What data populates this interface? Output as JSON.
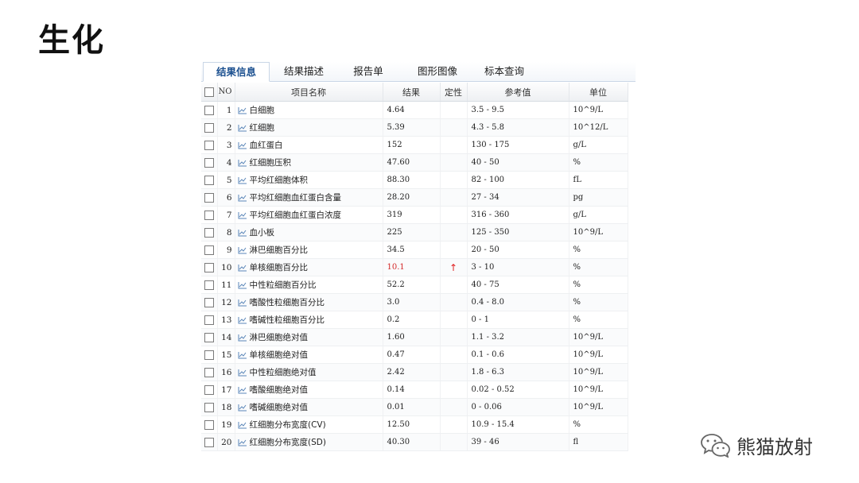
{
  "slide": {
    "title": "生化"
  },
  "tabs": [
    {
      "label": "结果信息",
      "active": true
    },
    {
      "label": "结果描述",
      "active": false
    },
    {
      "label": "报告单",
      "active": false
    },
    {
      "label": "图形图像",
      "active": false
    },
    {
      "label": "标本查询",
      "active": false
    }
  ],
  "table": {
    "headers": {
      "no": "NO",
      "name": "项目名称",
      "result": "结果",
      "flag": "定性",
      "ref": "参考值",
      "unit": "单位"
    },
    "rows": [
      {
        "no": "1",
        "name": "白细胞",
        "result": "4.64",
        "flag": "",
        "ref": "3.5 - 9.5",
        "unit": "10^9/L",
        "abnormal": false
      },
      {
        "no": "2",
        "name": "红细胞",
        "result": "5.39",
        "flag": "",
        "ref": "4.3 - 5.8",
        "unit": "10^12/L",
        "abnormal": false
      },
      {
        "no": "3",
        "name": "血红蛋白",
        "result": "152",
        "flag": "",
        "ref": "130 - 175",
        "unit": "g/L",
        "abnormal": false
      },
      {
        "no": "4",
        "name": "红细胞压积",
        "result": "47.60",
        "flag": "",
        "ref": "40 - 50",
        "unit": "%",
        "abnormal": false
      },
      {
        "no": "5",
        "name": "平均红细胞体积",
        "result": "88.30",
        "flag": "",
        "ref": "82 - 100",
        "unit": "fL",
        "abnormal": false
      },
      {
        "no": "6",
        "name": "平均红细胞血红蛋白含量",
        "result": "28.20",
        "flag": "",
        "ref": "27 - 34",
        "unit": "pg",
        "abnormal": false
      },
      {
        "no": "7",
        "name": "平均红细胞血红蛋白浓度",
        "result": "319",
        "flag": "",
        "ref": "316 - 360",
        "unit": "g/L",
        "abnormal": false
      },
      {
        "no": "8",
        "name": "血小板",
        "result": "225",
        "flag": "",
        "ref": "125 - 350",
        "unit": "10^9/L",
        "abnormal": false
      },
      {
        "no": "9",
        "name": "淋巴细胞百分比",
        "result": "34.5",
        "flag": "",
        "ref": "20 - 50",
        "unit": "%",
        "abnormal": false
      },
      {
        "no": "10",
        "name": "单核细胞百分比",
        "result": "10.1",
        "flag": "↑",
        "ref": "3 - 10",
        "unit": "%",
        "abnormal": true
      },
      {
        "no": "11",
        "name": "中性粒细胞百分比",
        "result": "52.2",
        "flag": "",
        "ref": "40 - 75",
        "unit": "%",
        "abnormal": false
      },
      {
        "no": "12",
        "name": "嗜酸性粒细胞百分比",
        "result": "3.0",
        "flag": "",
        "ref": "0.4 - 8.0",
        "unit": "%",
        "abnormal": false
      },
      {
        "no": "13",
        "name": "嗜碱性粒细胞百分比",
        "result": "0.2",
        "flag": "",
        "ref": "0 - 1",
        "unit": "%",
        "abnormal": false
      },
      {
        "no": "14",
        "name": "淋巴细胞绝对值",
        "result": "1.60",
        "flag": "",
        "ref": "1.1 - 3.2",
        "unit": "10^9/L",
        "abnormal": false
      },
      {
        "no": "15",
        "name": "单核细胞绝对值",
        "result": "0.47",
        "flag": "",
        "ref": "0.1 - 0.6",
        "unit": "10^9/L",
        "abnormal": false
      },
      {
        "no": "16",
        "name": "中性粒细胞绝对值",
        "result": "2.42",
        "flag": "",
        "ref": "1.8 - 6.3",
        "unit": "10^9/L",
        "abnormal": false
      },
      {
        "no": "17",
        "name": "嗜酸细胞绝对值",
        "result": "0.14",
        "flag": "",
        "ref": "0.02 - 0.52",
        "unit": "10^9/L",
        "abnormal": false
      },
      {
        "no": "18",
        "name": "嗜碱细胞绝对值",
        "result": "0.01",
        "flag": "",
        "ref": "0 - 0.06",
        "unit": "10^9/L",
        "abnormal": false
      },
      {
        "no": "19",
        "name": "红细胞分布宽度(CV)",
        "result": "12.50",
        "flag": "",
        "ref": "10.9 - 15.4",
        "unit": "%",
        "abnormal": false
      },
      {
        "no": "20",
        "name": "红细胞分布宽度(SD)",
        "result": "40.30",
        "flag": "",
        "ref": "39 - 46",
        "unit": "fl",
        "abnormal": false
      }
    ]
  },
  "colors": {
    "abnormal": "#d42a2a",
    "tab_active": "#1a4f8f"
  },
  "icons": {
    "row_icon": "trend-chart-icon",
    "watermark_icon": "wechat-icon"
  },
  "watermark": {
    "text": "熊猫放射"
  }
}
